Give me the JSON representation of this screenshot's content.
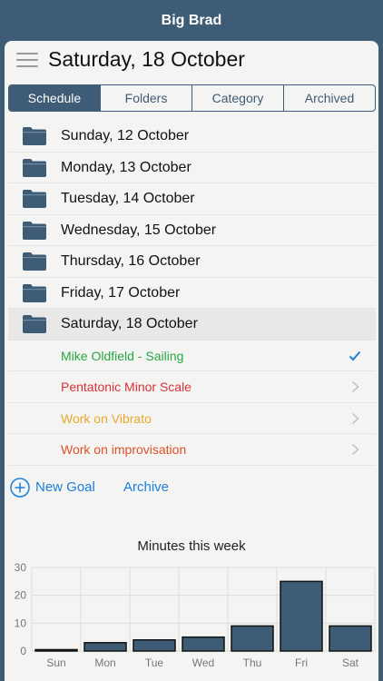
{
  "app": {
    "title": "Big Brad"
  },
  "header": {
    "date": "Saturday, 18 October"
  },
  "tabs": [
    {
      "label": "Schedule",
      "active": true
    },
    {
      "label": "Folders",
      "active": false
    },
    {
      "label": "Category",
      "active": false
    },
    {
      "label": "Archived",
      "active": false
    }
  ],
  "days": [
    "Sunday, 12 October",
    "Monday, 13 October",
    "Tuesday, 14 October",
    "Wednesday, 15 October",
    "Thursday, 16 October",
    "Friday, 17 October",
    "Saturday, 18 October"
  ],
  "selected_day_index": 6,
  "goals": [
    {
      "label": "Mike Oldfield - Sailing",
      "color": "#28a745",
      "status": "check"
    },
    {
      "label": "Pentatonic Minor Scale",
      "color": "#d9323a",
      "status": "chevron"
    },
    {
      "label": "Work on Vibrato",
      "color": "#e8a82c",
      "status": "chevron"
    },
    {
      "label": "Work on improvisation",
      "color": "#e0502a",
      "status": "chevron"
    }
  ],
  "actions": {
    "new_goal": "New Goal",
    "archive": "Archive"
  },
  "colors": {
    "accent": "#3e5c76",
    "link": "#1a7fd9"
  },
  "chart_data": {
    "type": "bar",
    "title": "Minutes this week",
    "categories": [
      "Sun",
      "Mon",
      "Tue",
      "Wed",
      "Thu",
      "Fri",
      "Sat"
    ],
    "values": [
      0.5,
      3,
      4,
      5,
      9,
      25,
      9
    ],
    "yticks": [
      0,
      10,
      20,
      30
    ],
    "ylim": [
      0,
      30
    ],
    "grid": true,
    "bar_color": "#3e5c76"
  }
}
